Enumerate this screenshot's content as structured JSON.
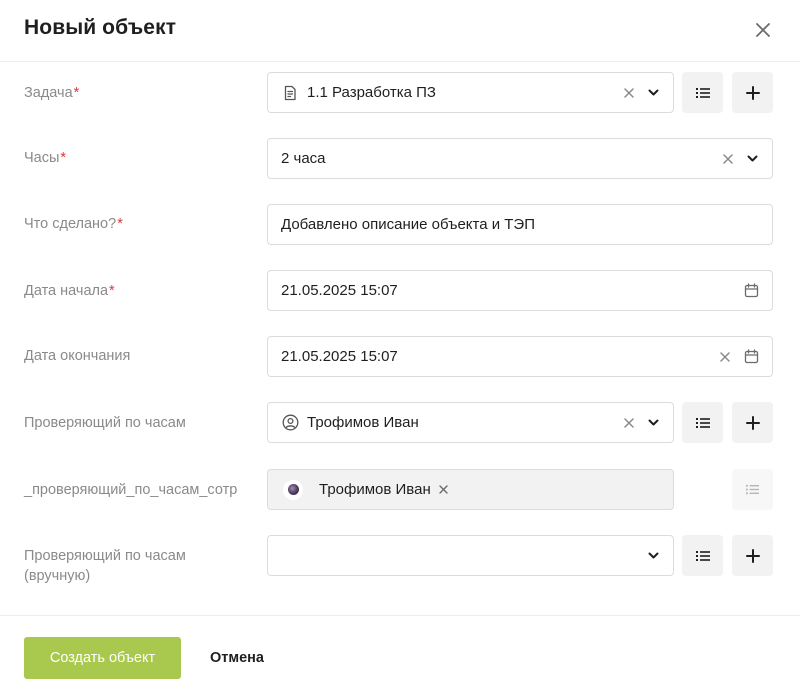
{
  "dialog": {
    "title": "Новый объект"
  },
  "required_mark": "*",
  "fields": {
    "task": {
      "label": "Задача",
      "value": "1.1 Разработка ПЗ"
    },
    "hours": {
      "label": "Часы",
      "value": "2 часа"
    },
    "done": {
      "label": "Что сделано?",
      "value": "Добавлено описание объекта и ТЭП"
    },
    "start": {
      "label": "Дата начала",
      "value": "21.05.2025 15:07"
    },
    "end": {
      "label": "Дата окончания",
      "value": "21.05.2025 15:07"
    },
    "reviewer": {
      "label": "Проверяющий по часам",
      "value": "Трофимов Иван"
    },
    "reviewer_emp": {
      "label": "_проверяющий_по_часам_сотр",
      "chip": "Трофимов Иван"
    },
    "reviewer_manual": {
      "label_line1": "Проверяющий по часам",
      "label_line2": "(вручную)",
      "value": ""
    }
  },
  "footer": {
    "create_label": "Создать объект",
    "cancel_label": "Отмена"
  },
  "colors": {
    "accent": "#a9c94e",
    "required": "#e0363c",
    "label": "#8a8a8a"
  },
  "icons": [
    "close-icon",
    "document-icon",
    "clear-icon",
    "chevron-down-icon",
    "list-icon",
    "plus-icon",
    "calendar-icon",
    "user-circle-icon",
    "avatar"
  ]
}
